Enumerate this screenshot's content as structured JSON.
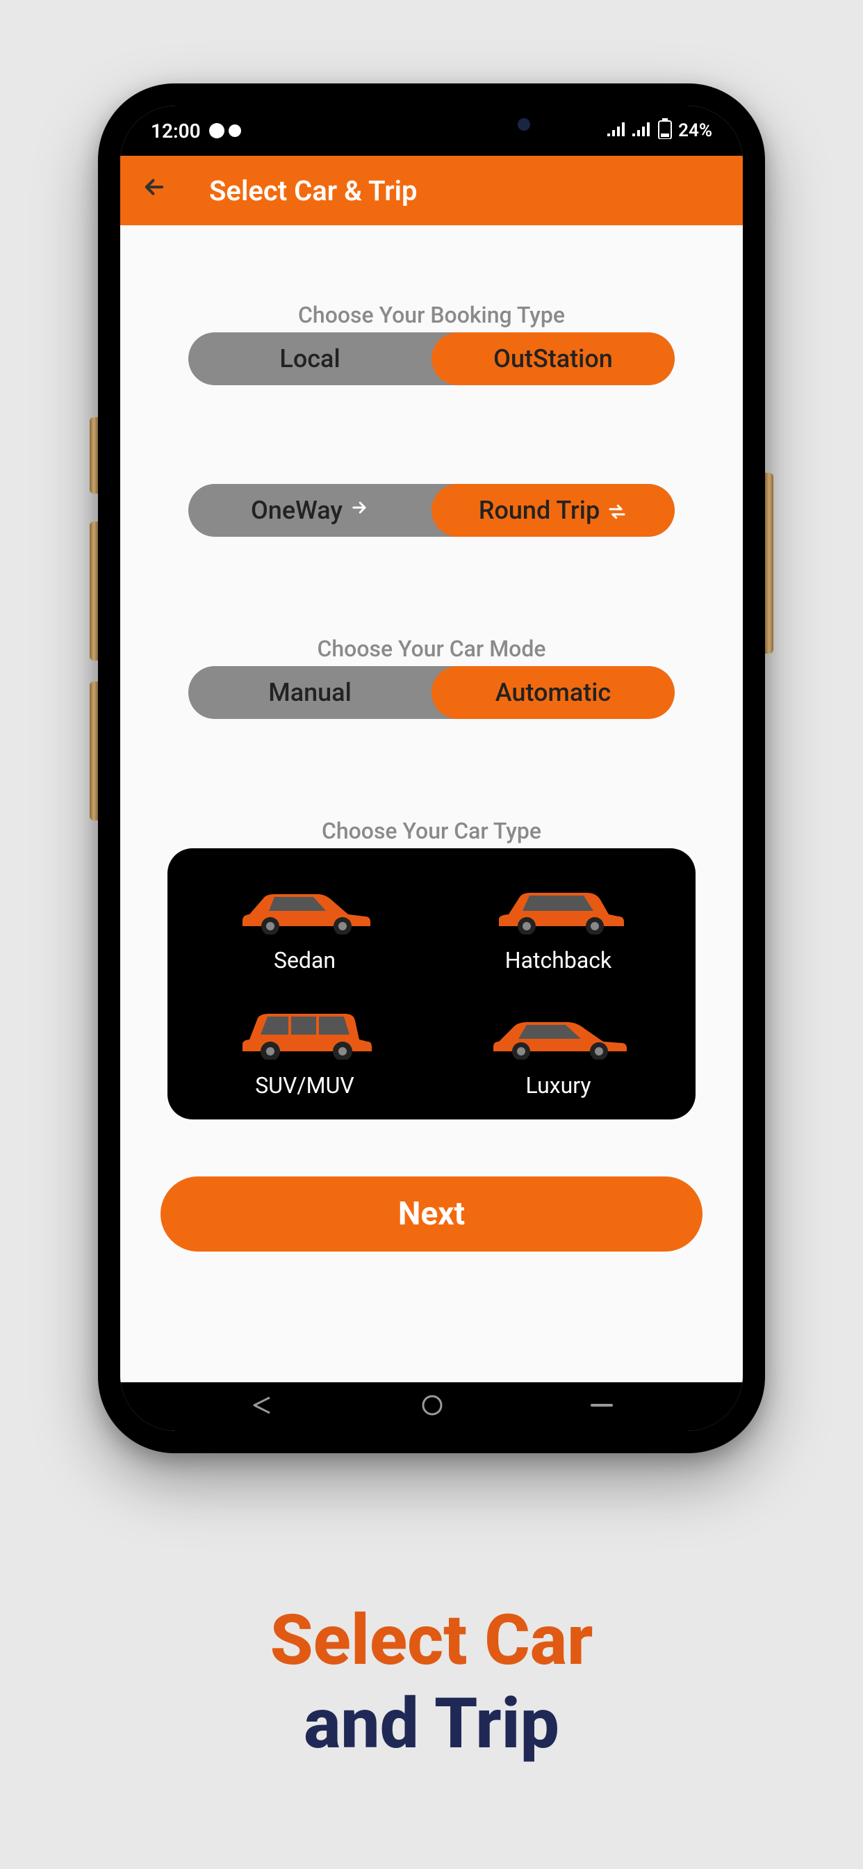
{
  "status": {
    "time": "12:00",
    "battery": "24%"
  },
  "header": {
    "title": "Select Car & Trip"
  },
  "booking": {
    "label": "Choose Your Booking Type",
    "options": {
      "a": "Local",
      "b": "OutStation"
    }
  },
  "trip": {
    "options": {
      "a": "OneWay",
      "b": "Round Trip"
    }
  },
  "carmode": {
    "label": "Choose Your Car Mode",
    "options": {
      "a": "Manual",
      "b": "Automatic"
    }
  },
  "cartype": {
    "label": "Choose Your Car Type",
    "items": {
      "a": "Sedan",
      "b": "Hatchback",
      "c": "SUV/MUV",
      "d": "Luxury"
    }
  },
  "actions": {
    "next": "Next"
  },
  "caption": {
    "line1": "Select Car",
    "line2": "and Trip"
  }
}
